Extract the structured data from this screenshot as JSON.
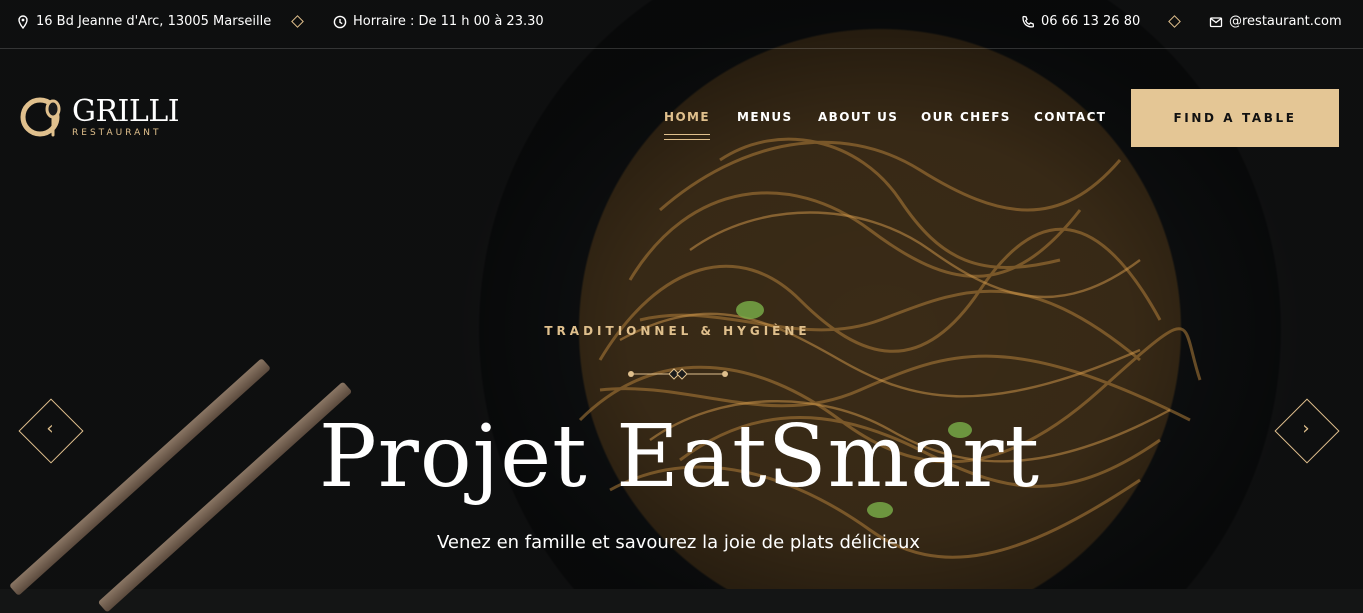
{
  "topbar": {
    "address": "16 Bd Jeanne d'Arc, 13005 Marseille",
    "hours": "Horraire : De 11 h 00 à 23.30",
    "phone": "06 66 13 26 80",
    "email": "@restaurant.com",
    "icons": {
      "address": "location-pin-icon",
      "hours": "clock-icon",
      "phone": "phone-icon",
      "email": "mail-icon"
    }
  },
  "logo": {
    "name": "GRILLI",
    "subtitle": "RESTAURANT"
  },
  "nav": {
    "items": [
      {
        "label": "HOME",
        "active": true
      },
      {
        "label": "MENUS",
        "active": false
      },
      {
        "label": "ABOUT US",
        "active": false
      },
      {
        "label": "OUR CHEFS",
        "active": false
      },
      {
        "label": "CONTACT",
        "active": false
      }
    ],
    "cta": "FIND A TABLE"
  },
  "hero": {
    "kicker": "TRADITIONNEL & HYGIÈNE",
    "title": "Projet EatSmart",
    "subtitle": "Venez en famille et savourez la joie de plats délicieux",
    "prev_glyph": "‹",
    "next_glyph": "›"
  },
  "colors": {
    "accent": "#e0c08d",
    "cta_bg": "#e4c695",
    "background": "#1a1b1c"
  }
}
